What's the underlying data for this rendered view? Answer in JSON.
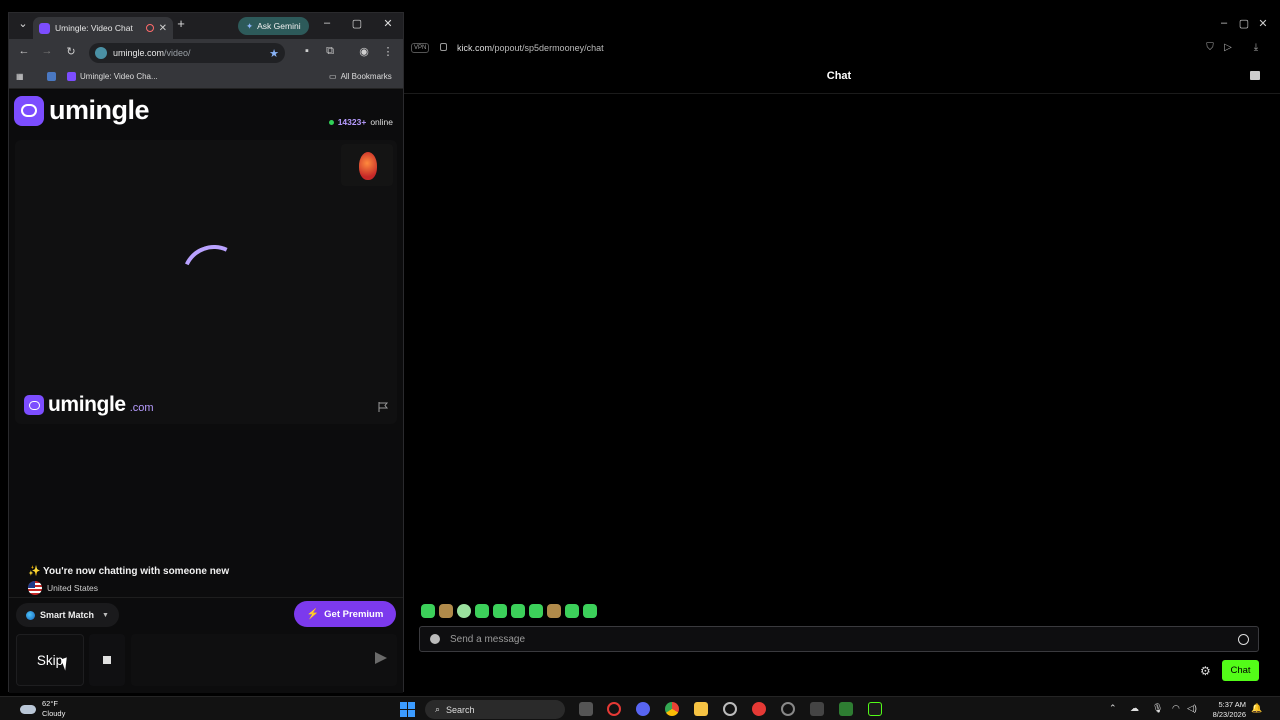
{
  "browser": {
    "tab_title": "Umingle: Video Chat",
    "ask_gemini": "Ask Gemini",
    "url_host": "umingle.com",
    "url_path": "/video/",
    "bookmark_1": "Umingle: Video Cha...",
    "all_bookmarks": "All Bookmarks"
  },
  "umingle": {
    "logo_text": "umingle",
    "online_count": "14323+",
    "online_label": "online",
    "watermark_text": "umingle",
    "watermark_domain": ".com",
    "new_chat_notice": "✨ You're now chatting with someone new",
    "country": "United States",
    "smart_match": "Smart Match",
    "get_premium": "Get Premium",
    "skip": "Skip"
  },
  "kick": {
    "vpn": "VPN",
    "url_host": "kick.com",
    "url_path": "/popout/sp5dermooney/chat",
    "chat_title": "Chat",
    "message_placeholder": "Send a message",
    "chat_button": "Chat"
  },
  "taskbar": {
    "temperature": "62°F",
    "weather": "Cloudy",
    "search": "Search",
    "time": "5:37 AM",
    "date": "8/23/2026"
  },
  "colors": {
    "umingle_purple": "#7c4dff",
    "premium_purple": "#7c3aed",
    "kick_green": "#53fc18"
  }
}
